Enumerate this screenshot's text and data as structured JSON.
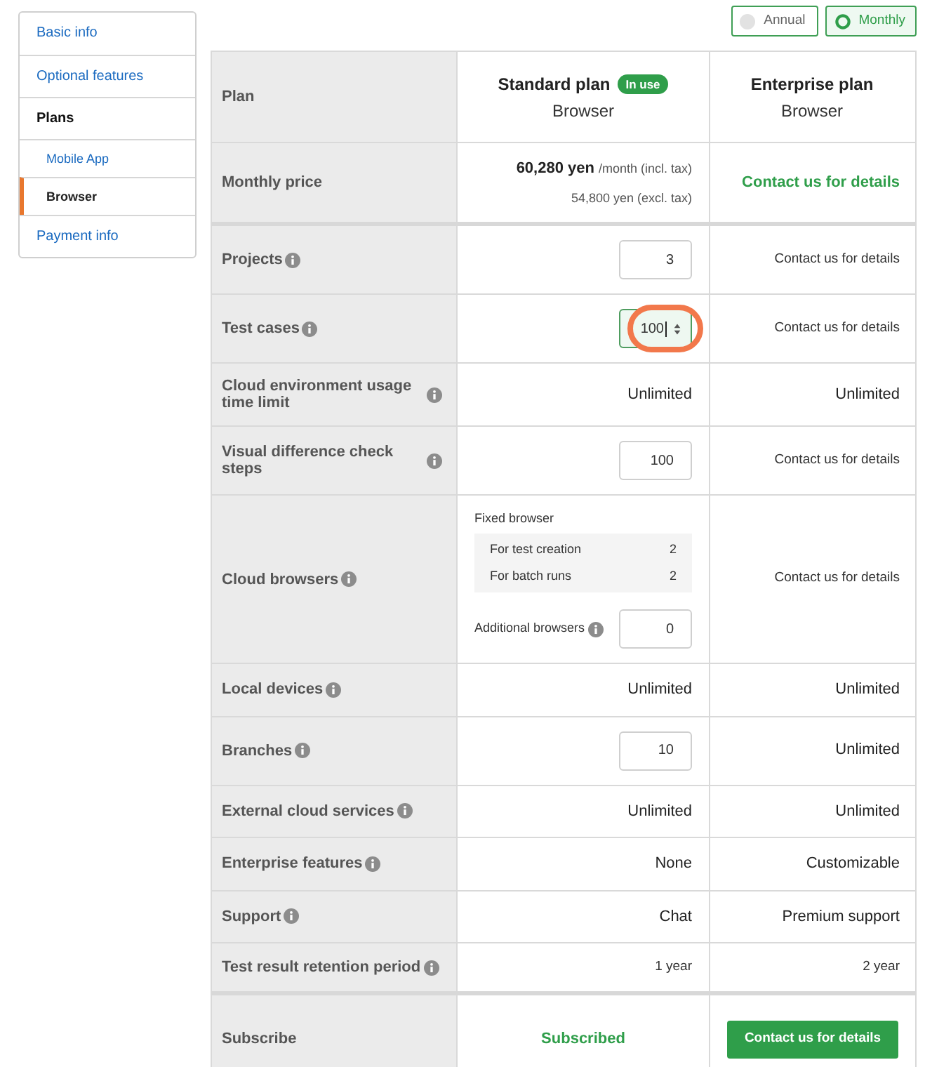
{
  "billing_options": [
    {
      "label": "Annual",
      "selected": false
    },
    {
      "label": "Monthly",
      "selected": true
    }
  ],
  "sidebar": {
    "items": [
      {
        "label": "Basic info",
        "selected": false,
        "expanded": false
      },
      {
        "label": "Optional features",
        "selected": false,
        "expanded": false
      },
      {
        "label": "Plans",
        "selected": false,
        "expanded": true,
        "children": [
          {
            "label": "Mobile App",
            "selected": false
          },
          {
            "label": "Browser",
            "selected": true
          }
        ]
      },
      {
        "label": "Payment info",
        "selected": false,
        "expanded": false
      }
    ]
  },
  "table": {
    "sections": [
      {
        "rows": [
          {
            "label": "Plan",
            "info": false,
            "cells": [
              {
                "kind": "plan",
                "name": "Standard plan",
                "badge": "In use",
                "subtitle": "Browser"
              },
              {
                "kind": "plan",
                "name": "Enterprise plan",
                "subtitle": "Browser"
              }
            ]
          },
          {
            "label": "Monthly price",
            "info": false,
            "cells": [
              {
                "kind": "price",
                "amount": "60,280 yen",
                "unit": "/month (incl. tax)",
                "note": "54,800 yen (excl. tax)"
              },
              {
                "kind": "emphasis",
                "text": "Contact us for details"
              }
            ]
          }
        ]
      },
      {
        "rows": [
          {
            "label": "Projects",
            "info": true,
            "cells": [
              {
                "kind": "input",
                "value": "3",
                "focused": false,
                "highlighted": false
              },
              {
                "kind": "note",
                "text": "Contact us for details"
              }
            ]
          },
          {
            "label": "Test cases",
            "info": true,
            "cells": [
              {
                "kind": "input",
                "value": "100",
                "focused": true,
                "highlighted": true
              },
              {
                "kind": "note",
                "text": "Contact us for details"
              }
            ]
          },
          {
            "label": "Cloud environment usage time limit",
            "info": true,
            "cells": [
              {
                "kind": "text",
                "text": "Unlimited"
              },
              {
                "kind": "text",
                "text": "Unlimited"
              }
            ]
          },
          {
            "label": "Visual difference check steps",
            "info": true,
            "cells": [
              {
                "kind": "input",
                "value": "100",
                "focused": false,
                "highlighted": false
              },
              {
                "kind": "note",
                "text": "Contact us for details"
              }
            ]
          },
          {
            "label": "Cloud browsers",
            "info": true,
            "cells": [
              {
                "kind": "browsers",
                "title": "Fixed browser",
                "items": [
                  {
                    "label": "For test creation",
                    "value": "2"
                  },
                  {
                    "label": "For batch runs",
                    "value": "2"
                  }
                ],
                "additional": {
                  "label": "Additional browsers",
                  "info": true,
                  "value": "0",
                  "focused": false,
                  "highlighted": false
                }
              },
              {
                "kind": "note",
                "text": "Contact us for details"
              }
            ]
          },
          {
            "label": "Local devices",
            "info": true,
            "cells": [
              {
                "kind": "text",
                "text": "Unlimited"
              },
              {
                "kind": "text",
                "text": "Unlimited"
              }
            ]
          },
          {
            "label": "Branches",
            "info": true,
            "cells": [
              {
                "kind": "input",
                "value": "10",
                "focused": false,
                "highlighted": false
              },
              {
                "kind": "text",
                "text": "Unlimited"
              }
            ]
          },
          {
            "label": "External cloud services",
            "info": true,
            "cells": [
              {
                "kind": "text",
                "text": "Unlimited"
              },
              {
                "kind": "text",
                "text": "Unlimited"
              }
            ]
          },
          {
            "label": "Enterprise features",
            "info": true,
            "cells": [
              {
                "kind": "text",
                "text": "None"
              },
              {
                "kind": "text",
                "text": "Customizable"
              }
            ]
          },
          {
            "label": "Support",
            "info": true,
            "cells": [
              {
                "kind": "text",
                "text": "Chat"
              },
              {
                "kind": "text",
                "text": "Premium support"
              }
            ]
          },
          {
            "label": "Test result retention period",
            "info": true,
            "cells": [
              {
                "kind": "note",
                "text": "1 year"
              },
              {
                "kind": "note",
                "text": "2 year"
              }
            ]
          }
        ]
      },
      {
        "rows": [
          {
            "label": "Subscribe",
            "info": false,
            "cells": [
              {
                "kind": "status",
                "text": "Subscribed"
              },
              {
                "kind": "button",
                "text": "Contact us for details"
              }
            ]
          }
        ]
      }
    ]
  }
}
